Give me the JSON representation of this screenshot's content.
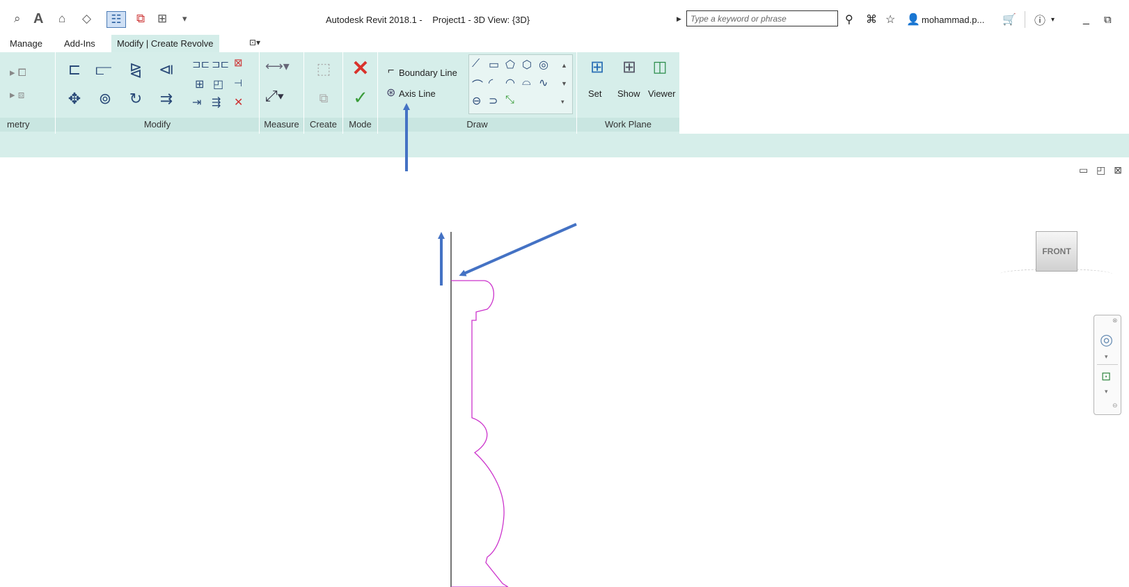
{
  "title_bar": {
    "title": "Autodesk Revit 2018.1 -    Project1 - 3D View: {3D}",
    "search_placeholder": "Type a keyword or phrase",
    "user": "mohammad.p...",
    "icons": [
      "binoculars-icon",
      "comm-icon",
      "favorites-star-icon",
      "user-icon",
      "cart-icon",
      "help-icon",
      "minimize-icon",
      "maximize-icon"
    ]
  },
  "tabs": [
    {
      "label": "Manage",
      "active": false
    },
    {
      "label": "Add-Ins",
      "active": false
    },
    {
      "label": "Modify | Create Revolve",
      "active": true
    }
  ],
  "ribbon": {
    "panels": {
      "geometry": "metry",
      "modify": "Modify",
      "measure": "Measure",
      "create": "Create",
      "mode": "Mode",
      "draw": "Draw",
      "work_plane": "Work Plane"
    },
    "draw_tools": {
      "boundary_line": "Boundary Line",
      "axis_line": "Axis Line"
    },
    "work_plane_tools": {
      "set": "Set",
      "show": "Show",
      "viewer": "Viewer"
    }
  },
  "viewport": {
    "viewcube_label": "FRONT",
    "view_controls": "▭ ◰ ⊠"
  },
  "colors": {
    "ribbon_bg": "#d6eeea",
    "sketch_line": "#cc33cc",
    "annotation_arrow": "#4472c4"
  }
}
